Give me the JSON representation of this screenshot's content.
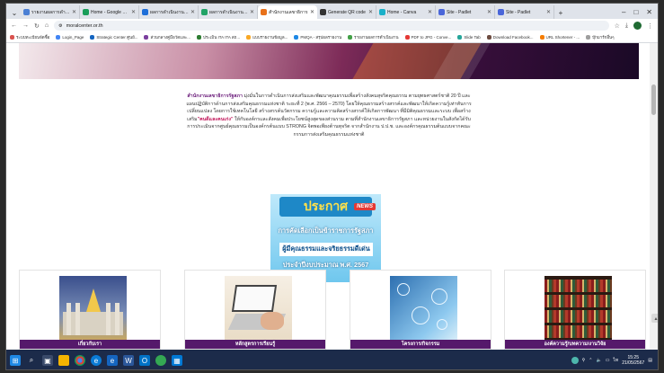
{
  "browser": {
    "tabs": [
      {
        "label": "รายงานผลการดำเนิน",
        "color": "#4a7fd4"
      },
      {
        "label": "Home - Google Drive",
        "color": "#1a9e5a"
      },
      {
        "label": "ผลการดำเนินงานตัว",
        "color": "#1e6fd9"
      },
      {
        "label": "ผลการดำเนินงานตัว",
        "color": "#21a366"
      },
      {
        "label": "สำนักงานเลขาธิการ",
        "color": "#e8711a",
        "active": true
      },
      {
        "label": "Generate QR code",
        "color": "#333333"
      },
      {
        "label": "Home - Canva",
        "color": "#1ab0c9"
      },
      {
        "label": "Site - Padlet",
        "color": "#4a66d9"
      },
      {
        "label": "Site - Padlet",
        "color": "#4a66d9"
      }
    ],
    "url": "moralcenter.or.th",
    "bookmarks": [
      {
        "label": "ระบบทะเบียนจัดซื้อ",
        "color": "#d9534f"
      },
      {
        "label": "Login_Page",
        "color": "#4285f4"
      },
      {
        "label": "Strategic Center ศูนย์...",
        "color": "#1565c0"
      },
      {
        "label": "ส่วนกลางคู่มือวัดและ...",
        "color": "#7b3f9e"
      },
      {
        "label": "ประเมิน ITA ITA สถ...",
        "color": "#2e7d32"
      },
      {
        "label": "แบบรายงานข้อมูล...",
        "color": "#f9a825"
      },
      {
        "label": "PMQA - สรุปผลรายงาน",
        "color": "#1e88e5"
      },
      {
        "label": "รายงานผลการดำเนินงาน",
        "color": "#43a047"
      },
      {
        "label": "PDF to JPG - Conve...",
        "color": "#e53935"
      },
      {
        "label": "Slide Tab",
        "color": "#26a69a"
      },
      {
        "label": "Download Facebook...",
        "color": "#6d4c41"
      },
      {
        "label": "URL Shortener - ...",
        "color": "#f57c00"
      },
      {
        "label": "บุ๊กมาร์กอื่นๆ",
        "color": "#9e9e9e"
      }
    ]
  },
  "intro": {
    "org_name": "สำนักงานเลขาธิการรัฐสภา",
    "text1": " มุ่งมั่นในการดำเนินการส่งเสริมและพัฒนาคุณธรรมเพื่อสร้างสังคมสุจริตคุณธรรม ตามยุทธศาสตร์ชาติ 20 ปี และแผนปฏิบัติการด้านการส่งเสริมคุณธรรมแห่งชาติ ระยะที่ 2 (พ.ศ. 2566 – 2570) โดยให้คุณธรรมสร้างสรรค์และพัฒนาให้เกิดความรู้เท่าทันการเปลี่ยนแปลง โดยการใช้เทคโนโลยี สร้างสรรค์นวัตกรรม ความรู้และความคิดสร้างสรรค์ให้เกิดการพัฒนา ที่มีมิติคุณธรรมและระบบ เพื่อสร้างเสริม",
    "highlight": "\"คนดีและคนเก่ง\"",
    "text2": " ให้กับองค์กรและสังคมเพื่อประโยชน์สูงสุดของส่วนรวม ตามที่สำนักงานเลขาธิการรัฐสภา และหน่วยงานในสังกัดได้รับการประเมินจากศูนย์คุณธรรมเป็นองค์กรต้นแบบ STRONG จิตพอเพียงต้านทุจริต จากสำนักงาน ป.ป.ช. และองค์กรคุณธรรมต้นแบบจากคณะกรรมการส่งเสริมคุณธรรมแห่งชาติ"
  },
  "poster": {
    "title": "ประกาศ",
    "badge": "NEWS",
    "line1": "การคัดเลือกเป็นข้าราชการรัฐสภา",
    "line2": "ผู้มีคุณธรรมและจริยธรรมดีเด่น",
    "line3": "ประจำปีงบประมาณ พ.ศ. 2567"
  },
  "cards": [
    {
      "label": "เกี่ยวกับเรา",
      "image": "parliament-building"
    },
    {
      "label": "หลักสูตรการเรียนรู้",
      "image": "laptop-e-learning"
    },
    {
      "label": "โครงการ/กิจกรรม",
      "image": "technology-network"
    },
    {
      "label": "องค์ความรู้/บทความ/งานวิจัย",
      "image": "library-bookshelves"
    }
  ],
  "taskbar": {
    "time": "15:25",
    "date": "21/05/2567"
  }
}
